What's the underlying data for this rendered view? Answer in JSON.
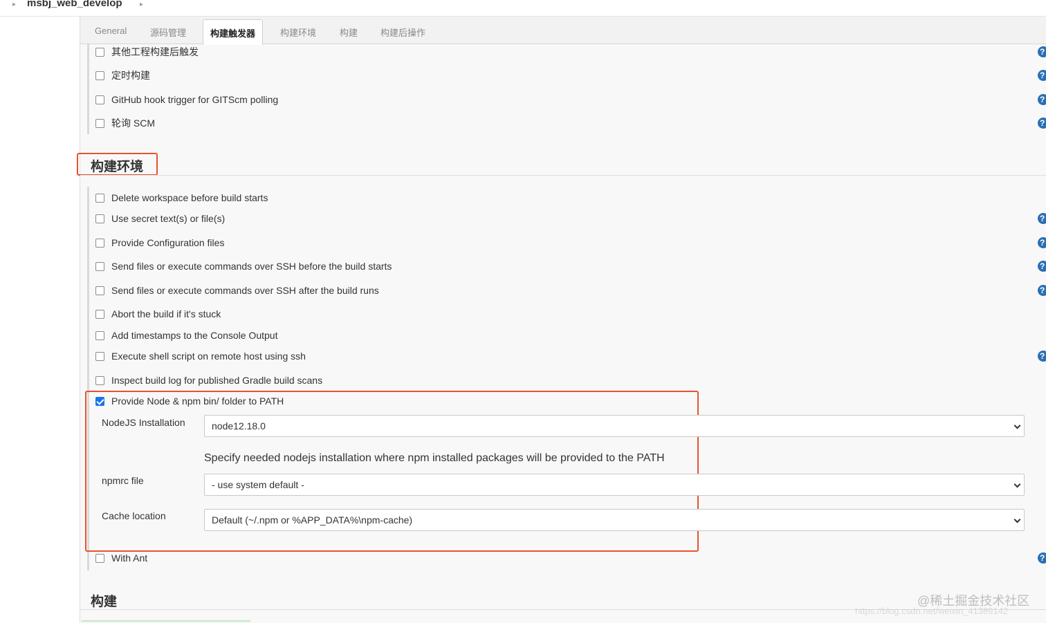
{
  "breadcrumb": {
    "project": "msbj_web_develop"
  },
  "tabs": [
    {
      "label": "General",
      "active": false
    },
    {
      "label": "源码管理",
      "active": false
    },
    {
      "label": "构建触发器",
      "active": true
    },
    {
      "label": "构建环境",
      "active": false
    },
    {
      "label": "构建",
      "active": false
    },
    {
      "label": "构建后操作",
      "active": false
    }
  ],
  "triggers": [
    {
      "label": "其他工程构建后触发",
      "checked": false
    },
    {
      "label": "定时构建",
      "checked": false
    },
    {
      "label": "GitHub hook trigger for GITScm polling",
      "checked": false
    },
    {
      "label": "轮询 SCM",
      "checked": false
    }
  ],
  "build_env": {
    "title": "构建环境",
    "options": [
      {
        "label": "Delete workspace before build starts",
        "checked": false
      },
      {
        "label": "Use secret text(s) or file(s)",
        "checked": false
      },
      {
        "label": "Provide Configuration files",
        "checked": false
      },
      {
        "label": "Send files or execute commands over SSH before the build starts",
        "checked": false
      },
      {
        "label": "Send files or execute commands over SSH after the build runs",
        "checked": false
      },
      {
        "label": "Abort the build if it's stuck",
        "checked": false
      },
      {
        "label": "Add timestamps to the Console Output",
        "checked": false
      },
      {
        "label": "Execute shell script on remote host using ssh",
        "checked": false
      },
      {
        "label": "Inspect build log for published Gradle build scans",
        "checked": false
      },
      {
        "label": "Provide Node & npm bin/ folder to PATH",
        "checked": true
      }
    ],
    "node": {
      "nodejs_label": "NodeJS Installation",
      "nodejs_value": "node12.18.0",
      "nodejs_hint": "Specify needed nodejs installation where npm installed packages will be provided to the PATH",
      "npmrc_label": "npmrc file",
      "npmrc_value": "- use system default -",
      "cache_label": "Cache location",
      "cache_value": "Default (~/.npm or %APP_DATA%\\npm-cache)"
    },
    "with_ant": {
      "label": "With Ant",
      "checked": false
    }
  },
  "build": {
    "title": "构建"
  },
  "help_glyph": "?",
  "watermark": {
    "line1": "@稀土掘金技术社区",
    "line2": "https://blog.csdn.net/weixin_41389142"
  },
  "colors": {
    "accent_red": "#e5532d",
    "checkbox_blue": "#1a73e8",
    "help_blue": "#2a6fb5"
  }
}
